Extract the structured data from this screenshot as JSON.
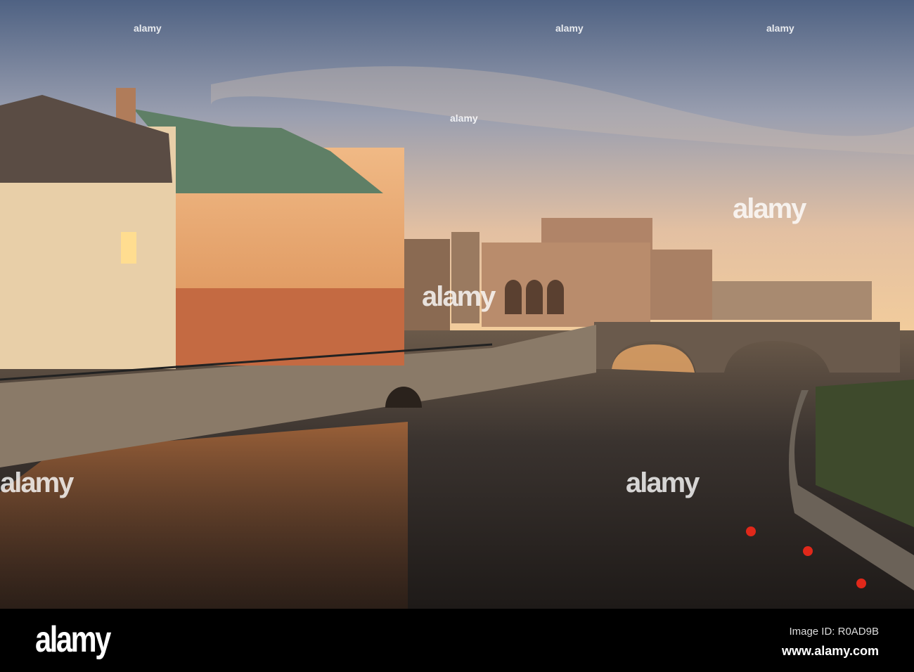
{
  "photo": {
    "subject": "Stockholm waterfront at sunset",
    "colors": {
      "sky_top": "#56688a",
      "sky_horizon": "#efc79c",
      "water": "#2a2420",
      "facade": "#e9a36a",
      "roof": "#5f7f66"
    }
  },
  "watermark": {
    "text": "alamy"
  },
  "footer": {
    "logo": "alamy",
    "image_id": "Image ID: R0AD9B",
    "url": "www.alamy.com"
  }
}
